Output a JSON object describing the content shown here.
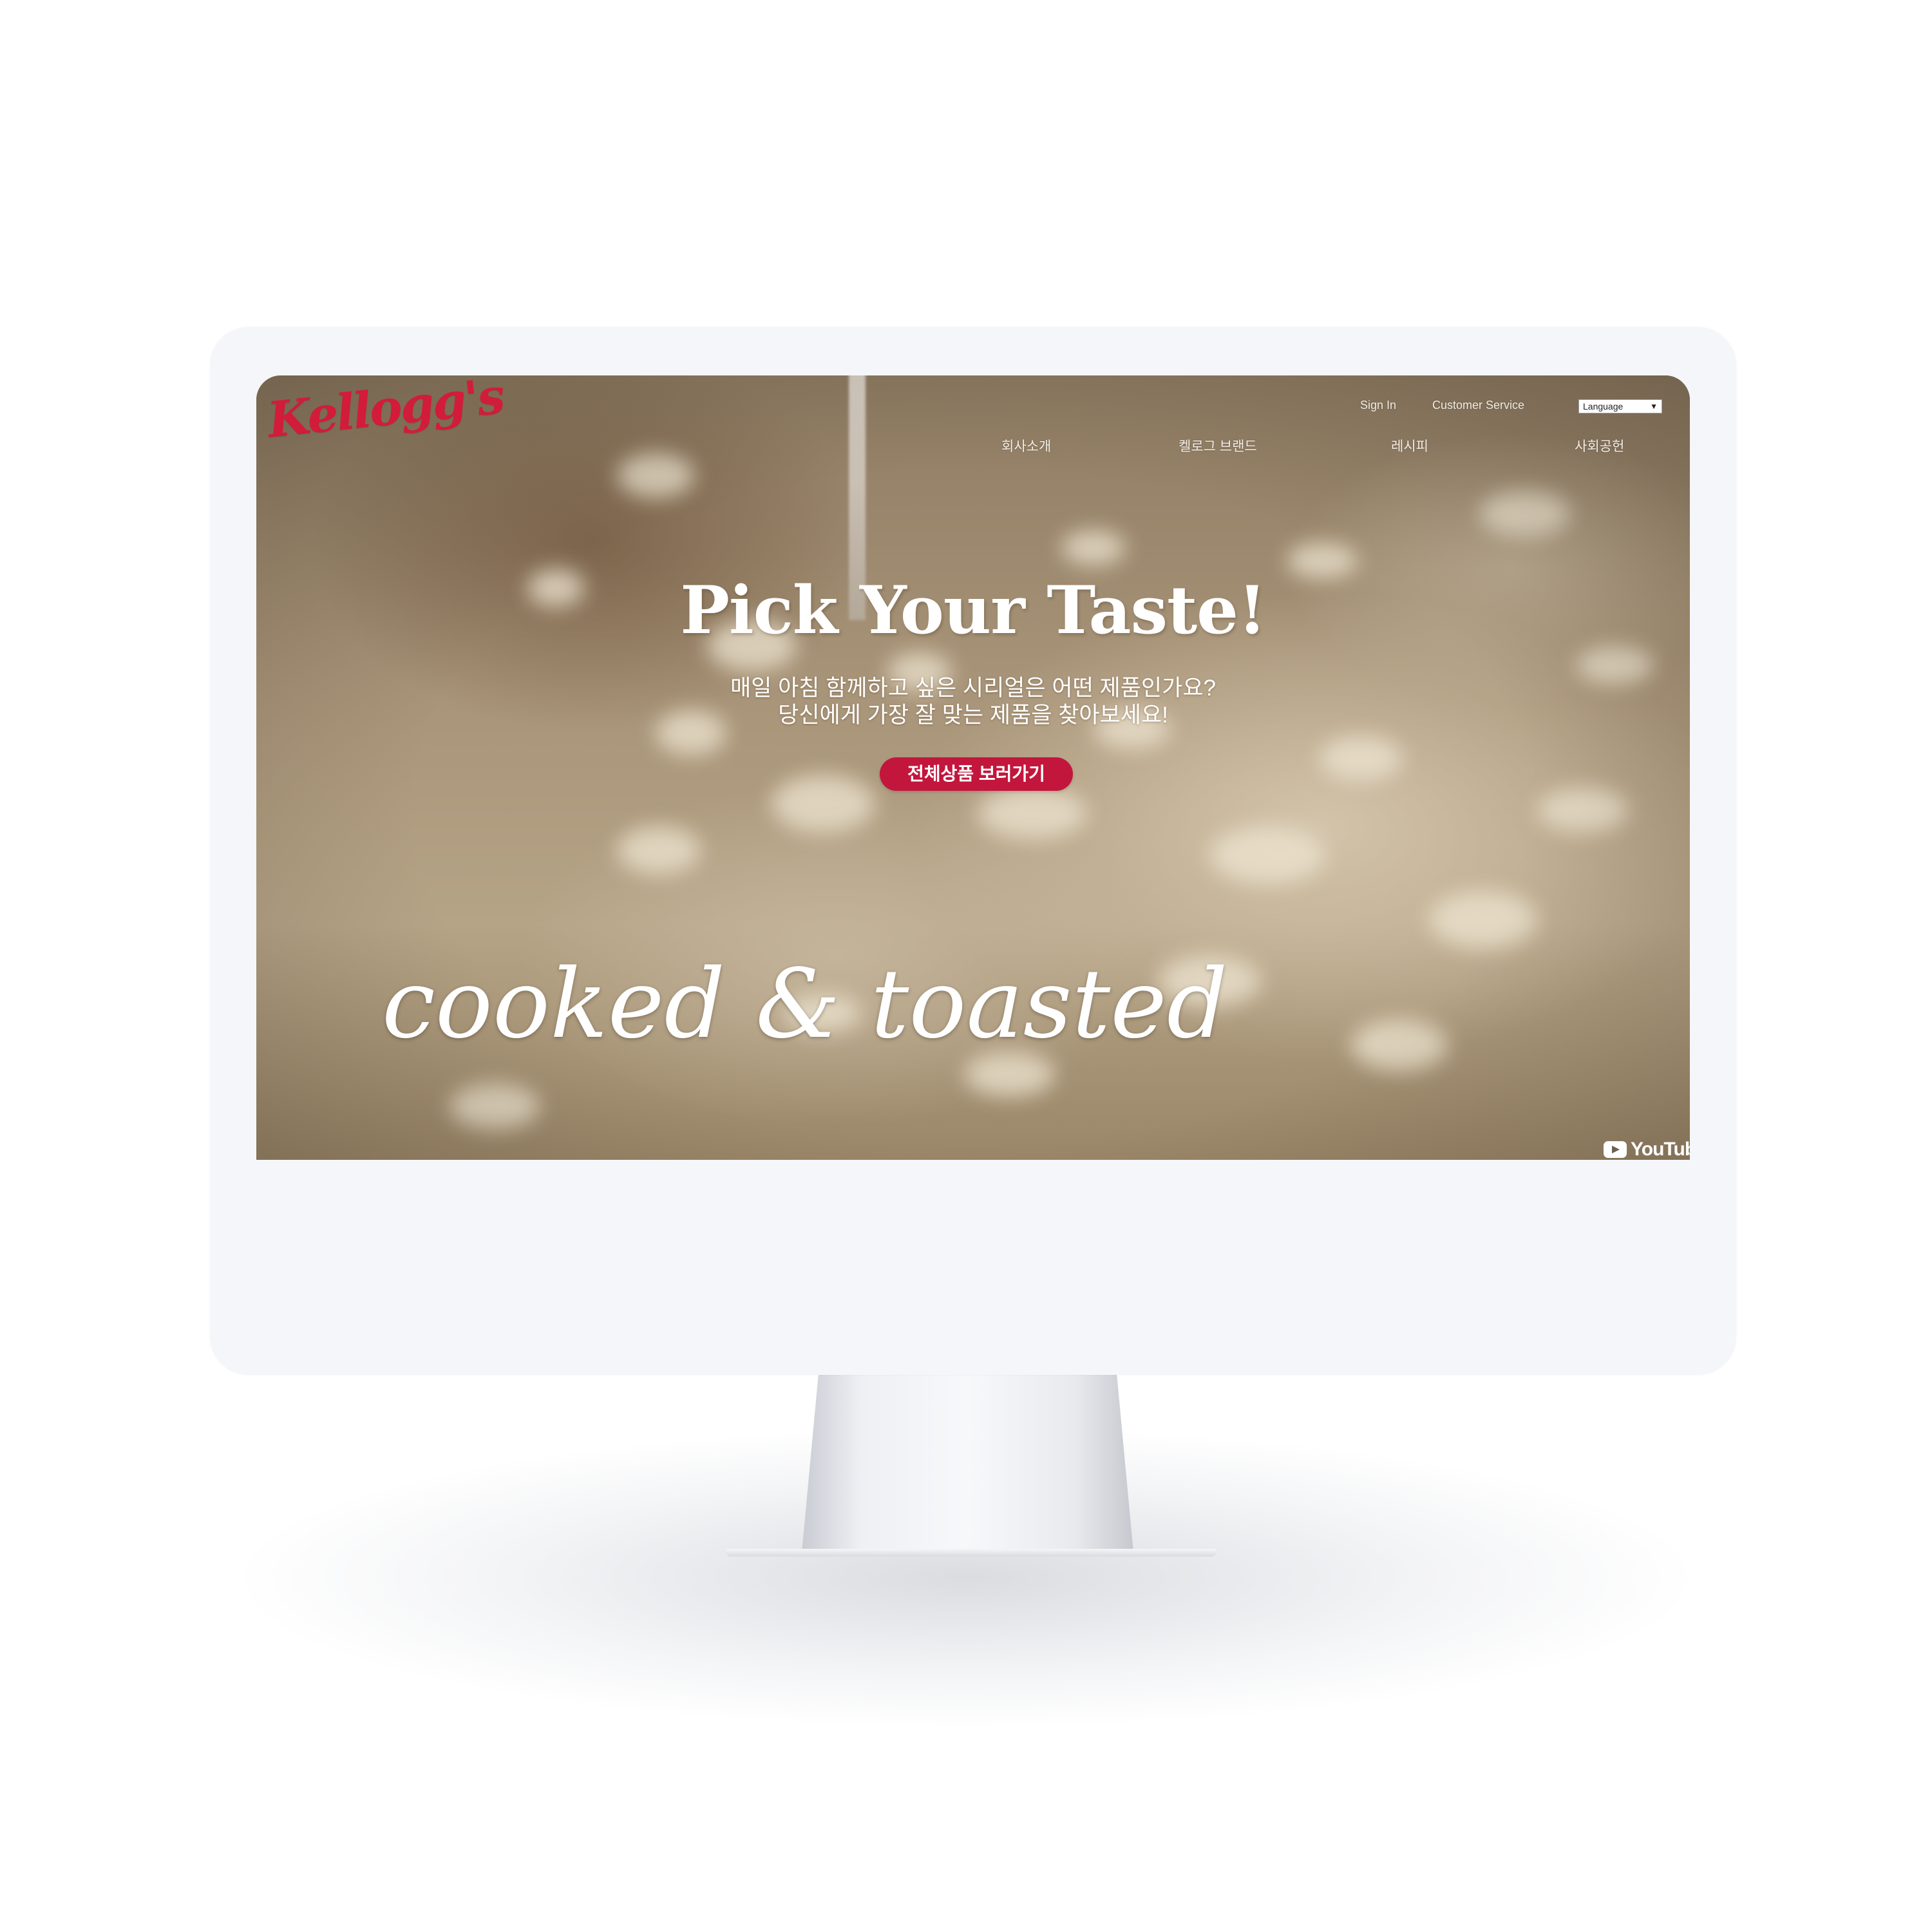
{
  "brand": {
    "logo_text": "Kellogg's",
    "color": "#d31b3a"
  },
  "header": {
    "utility": {
      "sign_in": "Sign In",
      "customer_service": "Customer Service"
    },
    "language_select": {
      "selected": "Language",
      "arrow": "▼"
    },
    "nav": [
      "회사소개",
      "켈로그 브랜드",
      "레시피",
      "사회공헌"
    ]
  },
  "hero": {
    "title": "Pick Your Taste!",
    "subtitle_lines": [
      "매일 아침 함께하고 싶은 시리얼은 어떤 제품인가요?",
      "당신에게 가장 잘 맞는 제품을 찾아보세요!"
    ],
    "cta_label": "전체상품 보러가기",
    "cta_color": "#c3163c",
    "video_caption": "cooked & toasted"
  },
  "video": {
    "provider_label": "YouTube",
    "icon": "youtube-play-icon"
  }
}
